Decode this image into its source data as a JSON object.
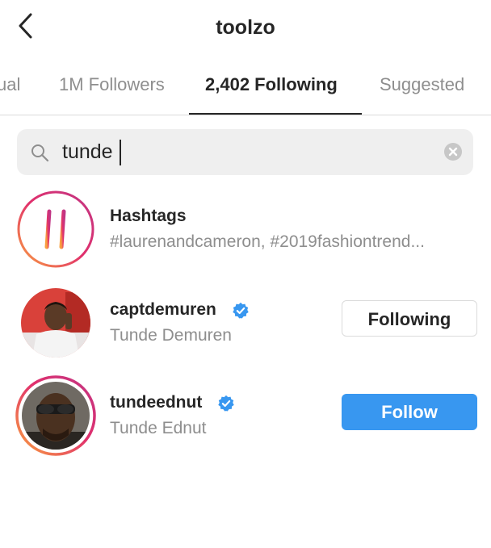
{
  "header": {
    "title": "toolzo"
  },
  "tabs": [
    {
      "label": "ual"
    },
    {
      "label": "1M Followers"
    },
    {
      "label": "2,402 Following"
    },
    {
      "label": "Suggested"
    }
  ],
  "search": {
    "value": "tunde"
  },
  "results": [
    {
      "primary": "Hashtags",
      "secondary": "#laurenandcameron, #2019fashiontrend..."
    },
    {
      "primary": "captdemuren",
      "secondary": "Tunde Demuren",
      "button": "Following"
    },
    {
      "primary": "tundeednut",
      "secondary": "Tunde Ednut",
      "button": "Follow"
    }
  ],
  "colors": {
    "accent": "#3897f0",
    "verified": "#3897f0",
    "secondary_text": "#8e8e8e"
  }
}
